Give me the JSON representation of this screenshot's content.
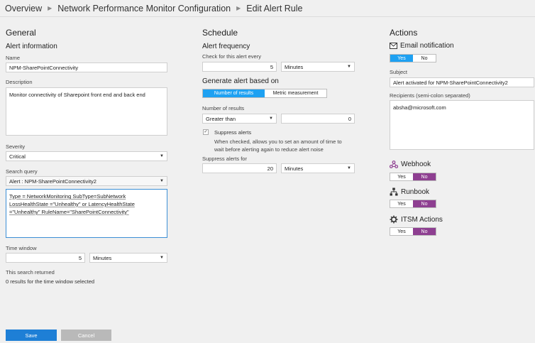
{
  "breadcrumb": {
    "items": [
      "Overview",
      "Network Performance Monitor Configuration",
      "Edit Alert Rule"
    ]
  },
  "general": {
    "title": "General",
    "alert_info_title": "Alert information",
    "name_label": "Name",
    "name_value": "NPM-SharePointConnectivity",
    "description_label": "Description",
    "description_value": "Monitor connectivity of Sharepoint front end and back end",
    "severity_label": "Severity",
    "severity_value": "Critical",
    "search_query_label": "Search query",
    "search_query_select": "Alert : NPM-SharePointConnectivity2",
    "query_lines": [
      "Type = NetworkMonitoring SubType=SubNetwork",
      "LossHealthState =\"Unhealthy\" or LatencyHealthState",
      "=\"Unhealthy\"  RuleName=\"SharePointConnectivity\""
    ],
    "time_window_label": "Time window",
    "time_window_value": "5",
    "time_window_unit": "Minutes",
    "search_returned_label": "This search returned",
    "results_count": "0 results",
    "results_suffix": " for the time window selected"
  },
  "schedule": {
    "title": "Schedule",
    "frequency_title": "Alert frequency",
    "check_label": "Check for this alert every",
    "check_value": "5",
    "check_unit": "Minutes",
    "generate_title": "Generate alert based on",
    "tab_number": "Number of results",
    "tab_metric": "Metric measurement",
    "number_results_label": "Number of results",
    "operator_value": "Greater than",
    "threshold_value": "0",
    "suppress_label": "Suppress alerts",
    "suppress_help_1": "When checked, allows you to set an amount of time to",
    "suppress_help_2": "wait before alerting again to reduce alert noise",
    "suppress_for_label": "Suppress alerts for",
    "suppress_value": "20",
    "suppress_unit": "Minutes"
  },
  "actions": {
    "title": "Actions",
    "email_title": "Email notification",
    "yes": "Yes",
    "no": "No",
    "subject_label": "Subject",
    "subject_value": "Alert activated for NPM-SharePointConnectivity2",
    "recipients_label": "Recipients (semi-colon separated)",
    "recipients_value": "absha@microsoft.com",
    "webhook_title": "Webhook",
    "runbook_title": "Runbook",
    "itsm_title": "ITSM Actions"
  },
  "footer": {
    "save_label": "Save",
    "cancel_label": "Cancel"
  },
  "colors": {
    "accent_blue": "#1ea1f2",
    "toggle_purple": "#8e3f91",
    "save_blue": "#1e7fd6"
  }
}
